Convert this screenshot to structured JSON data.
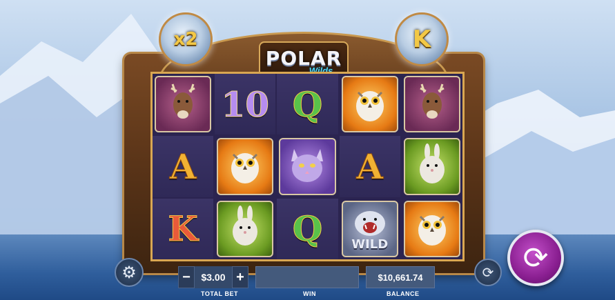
{
  "title": {
    "main": "POLAR",
    "sub": "Wilds"
  },
  "orbs": {
    "left": "x2",
    "right": "K"
  },
  "reels": [
    [
      {
        "symbol": "deer",
        "label": ""
      },
      {
        "symbol": "A",
        "label": "A"
      },
      {
        "symbol": "K",
        "label": "K"
      }
    ],
    [
      {
        "symbol": "10",
        "label": "10"
      },
      {
        "symbol": "owl",
        "label": ""
      },
      {
        "symbol": "rabbit",
        "label": ""
      }
    ],
    [
      {
        "symbol": "Q",
        "label": "Q"
      },
      {
        "symbol": "lynx",
        "label": ""
      },
      {
        "symbol": "Q",
        "label": "Q"
      }
    ],
    [
      {
        "symbol": "owl",
        "label": ""
      },
      {
        "symbol": "A",
        "label": "A"
      },
      {
        "symbol": "wild",
        "label": "WILD"
      }
    ],
    [
      {
        "symbol": "deer",
        "label": ""
      },
      {
        "symbol": "rabbit",
        "label": ""
      },
      {
        "symbol": "owl",
        "label": ""
      }
    ]
  ],
  "controls": {
    "minus": "−",
    "plus": "+",
    "bet_value": "$3.00",
    "bet_label": "TOTAL BET",
    "win_label": "WIN",
    "win_value": "",
    "balance_value": "$10,661.74",
    "balance_label": "BALANCE"
  },
  "icons": {
    "settings": "gear-icon",
    "autoplay": "autoplay-icon",
    "spin": "spin-icon"
  },
  "colors": {
    "spin_button": "#8a1f91",
    "frame_gold": "#d9a752",
    "reel_bg": "#2f2957"
  }
}
